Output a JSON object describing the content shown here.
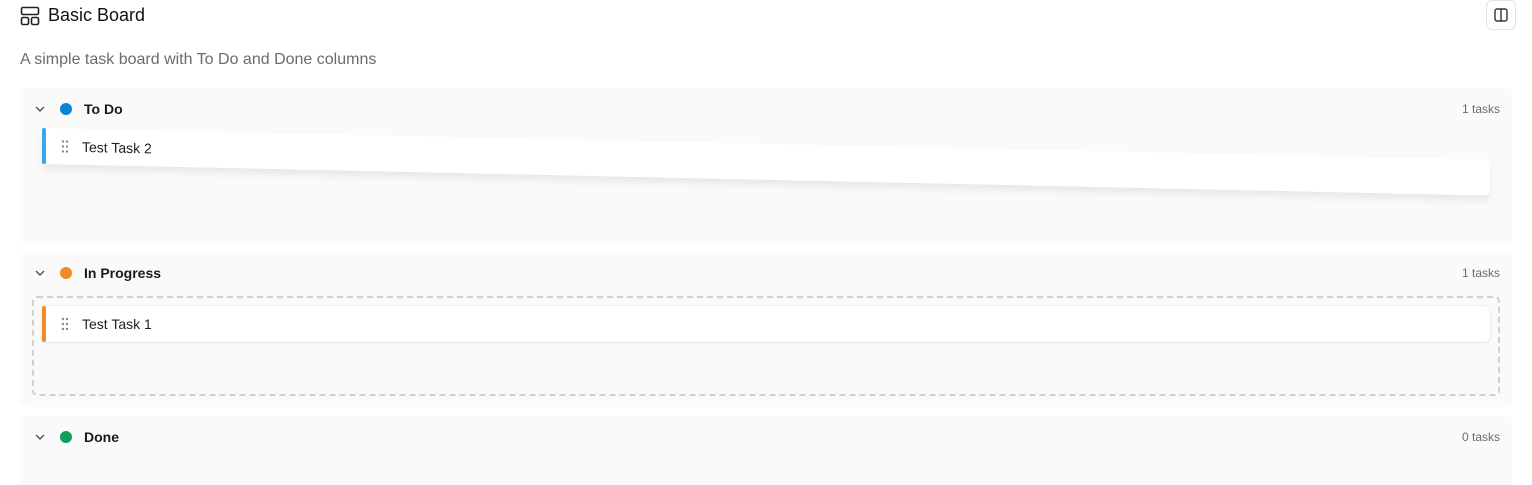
{
  "header": {
    "title": "Basic Board",
    "icon": "board-layout-icon",
    "toggle_icon": "split-view-icon"
  },
  "subtitle": "A simple task board with To Do and Done columns",
  "columns": [
    {
      "name": "To Do",
      "color": "#0a84d6",
      "count": "1 tasks",
      "tasks": [
        {
          "title": "Test Task 2",
          "accent": "#3aa7e8"
        }
      ]
    },
    {
      "name": "In Progress",
      "color": "#f08c28",
      "count": "1 tasks",
      "tasks": [
        {
          "title": "Test Task 1",
          "accent": "#f08c28"
        }
      ]
    },
    {
      "name": "Done",
      "color": "#0f9d58",
      "count": "0 tasks",
      "tasks": []
    }
  ]
}
